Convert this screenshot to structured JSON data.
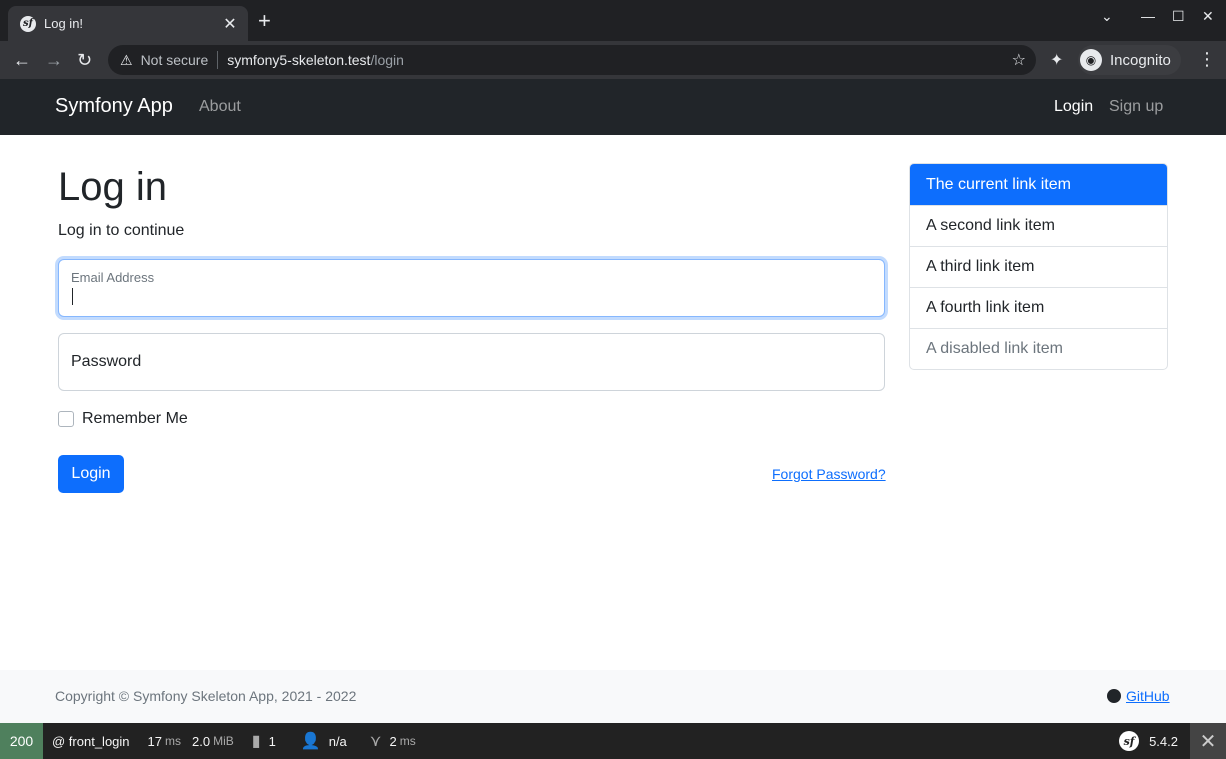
{
  "browser": {
    "tab_title": "Log in!",
    "tab_favicon": "symfony-icon",
    "new_tab": "+",
    "address": {
      "security_label": "Not secure",
      "host": "symfony5-skeleton.test",
      "path": "/login"
    },
    "profile_label": "Incognito"
  },
  "navbar": {
    "brand": "Symfony App",
    "about": "About",
    "login": "Login",
    "signup": "Sign up"
  },
  "page": {
    "title": "Log in",
    "subtitle": "Log in to continue",
    "email_label": "Email Address",
    "password_label": "Password",
    "remember_label": "Remember Me",
    "login_button": "Login",
    "forgot_link": "Forgot Password?"
  },
  "list_group": [
    {
      "label": "The current link item",
      "state": "active"
    },
    {
      "label": "A second link item",
      "state": "normal"
    },
    {
      "label": "A third link item",
      "state": "normal"
    },
    {
      "label": "A fourth link item",
      "state": "normal"
    },
    {
      "label": "A disabled link item",
      "state": "disabled"
    }
  ],
  "footer": {
    "copyright": "Copyright © Symfony Skeleton App, 2021 - 2022",
    "github": "GitHub"
  },
  "toolbar": {
    "status_code": "200",
    "route": "@ front_login",
    "time_value": "17",
    "time_unit": "ms",
    "memory_value": "2.0",
    "memory_unit": "MiB",
    "logs_count": "1",
    "user": "n/a",
    "twig_value": "2",
    "twig_unit": "ms",
    "symfony_version": "5.4.2"
  },
  "colors": {
    "primary": "#0d6efd",
    "navbar_bg": "#212529",
    "status_ok": "#4f805d"
  }
}
